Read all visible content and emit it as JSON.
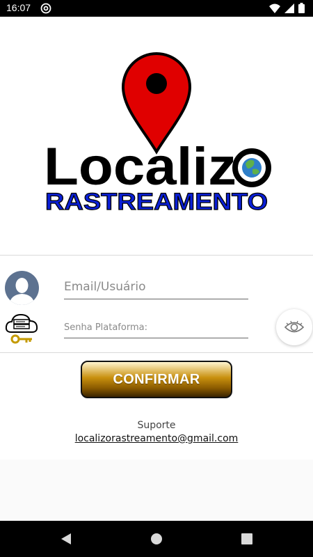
{
  "status_bar": {
    "time": "16:07",
    "app_icon": "at-sign-icon",
    "icons": [
      "wifi-icon",
      "signal-icon",
      "battery-icon"
    ]
  },
  "logo": {
    "word": "Localiz",
    "subtitle": "RASTREAMENTO",
    "colors": {
      "pin": "#e00000",
      "word": "#000000",
      "subtitle": "#0a1fd6",
      "globe": "#2f7fc8"
    }
  },
  "form": {
    "email_placeholder": "Email/Usuário",
    "password_placeholder": "Senha Plataforma:",
    "user_icon": "user-avatar-icon",
    "password_icon": "cloud-key-icon",
    "toggle_visibility_icon": "eye-icon"
  },
  "actions": {
    "confirm_label": "CONFIRMAR"
  },
  "support": {
    "label": "Suporte",
    "email": "localizorastreamento@gmail.com"
  },
  "nav_bar": {
    "icons": [
      "back-icon",
      "home-icon",
      "recents-icon"
    ]
  }
}
